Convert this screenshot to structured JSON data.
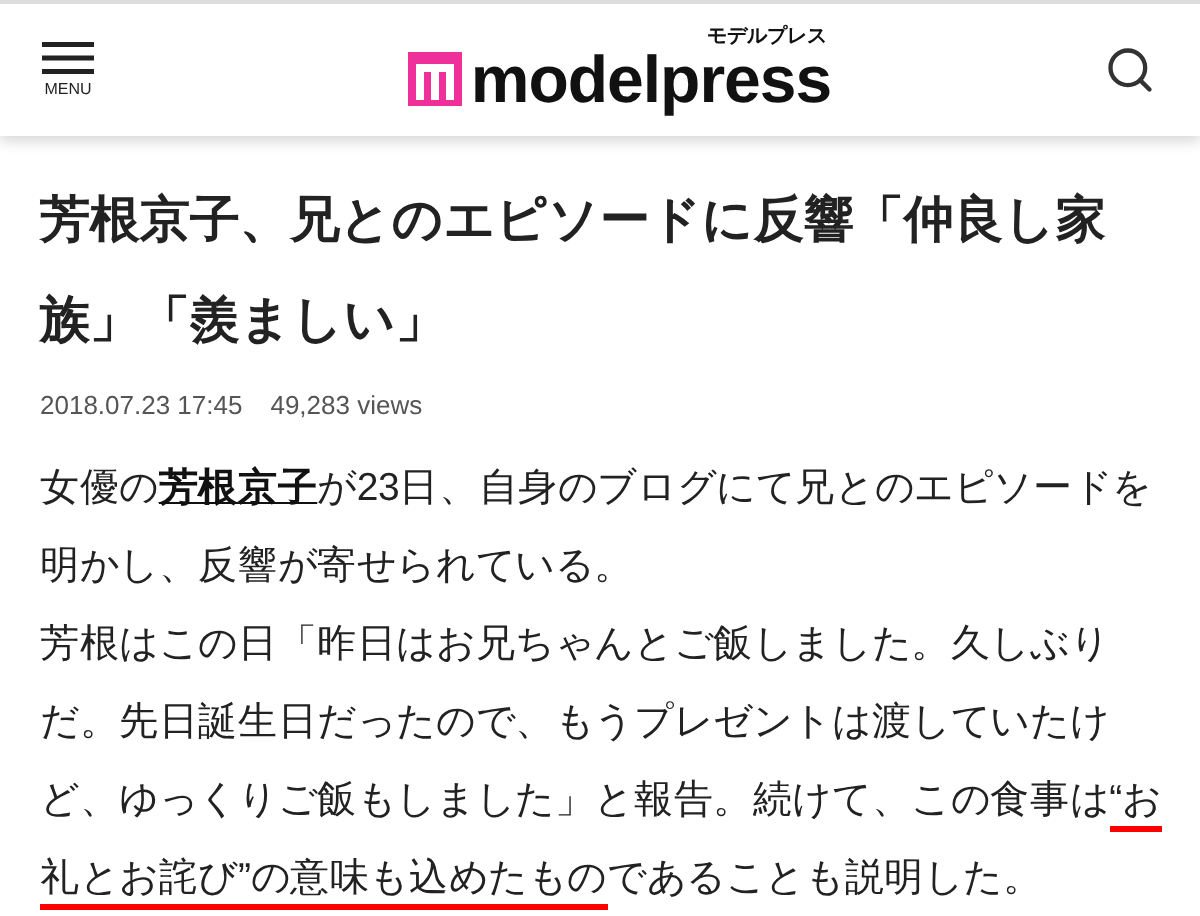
{
  "header": {
    "menu_label": "MENU",
    "logo_text": "modelpress",
    "logo_kana": "モデルプレス"
  },
  "article": {
    "title": "芳根京子、兄とのエピソードに反響「仲良し家族」「羨ましい」",
    "date": "2018.07.23 17:45",
    "views": "49,283 views",
    "paragraphs": [
      {
        "segments": [
          {
            "kind": "text",
            "text": "女優の"
          },
          {
            "kind": "link",
            "text": "芳根京子"
          },
          {
            "kind": "text",
            "text": "が23日、自身のブログにて兄とのエピソードを明かし、反響が寄せられている。"
          }
        ]
      },
      {
        "segments": [
          {
            "kind": "text",
            "text": "芳根はこの日「昨日はお兄ちゃんとご飯しました。久しぶりだ。先日誕生日だったので、もうプレゼントは渡していたけど、ゆっくりご飯もしました」と報告。続けて、この食事は"
          },
          {
            "kind": "underlined",
            "text": "“お礼とお詫び”の意味も込めたもの"
          },
          {
            "kind": "text",
            "text": "であることも説明した。"
          }
        ]
      }
    ]
  }
}
